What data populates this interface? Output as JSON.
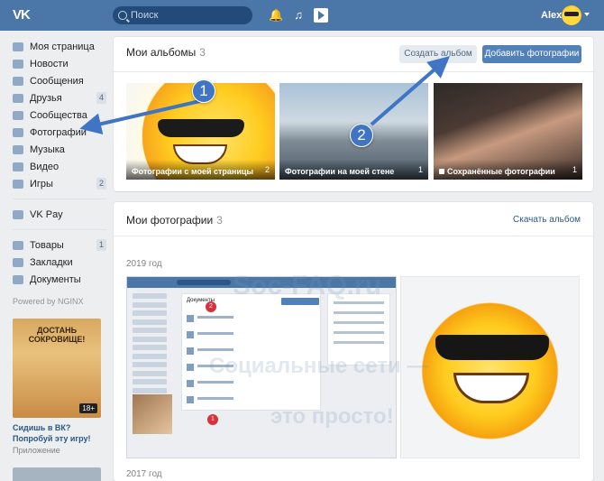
{
  "topbar": {
    "logo": "VK",
    "search_placeholder": "Поиск",
    "user_name": "Alex"
  },
  "sidebar": {
    "items": [
      {
        "label": "Моя страница",
        "icon": "home-icon"
      },
      {
        "label": "Новости",
        "icon": "news-icon"
      },
      {
        "label": "Сообщения",
        "icon": "messages-icon"
      },
      {
        "label": "Друзья",
        "icon": "friends-icon",
        "badge": "4"
      },
      {
        "label": "Сообщества",
        "icon": "groups-icon"
      },
      {
        "label": "Фотографии",
        "icon": "camera-icon"
      },
      {
        "label": "Музыка",
        "icon": "music-icon"
      },
      {
        "label": "Видео",
        "icon": "video-icon"
      },
      {
        "label": "Игры",
        "icon": "games-icon",
        "badge": "2"
      }
    ],
    "vkpay": "VK Pay",
    "items2": [
      {
        "label": "Товары",
        "icon": "goods-icon",
        "badge": "1"
      },
      {
        "label": "Закладки",
        "icon": "bookmark-icon"
      },
      {
        "label": "Документы",
        "icon": "documents-icon"
      }
    ],
    "powered": "Powered by NGINX",
    "promo": {
      "image_title": "ДОСТАНЬ СОКРОВИЩЕ!",
      "age": "18+",
      "text": "Сидишь в ВК? Попробуй эту игру!",
      "sub": "Приложение"
    }
  },
  "albums": {
    "title": "Мои альбомы",
    "count": "3",
    "create_button": "Создать альбом",
    "add_button": "Добавить фотографии",
    "items": [
      {
        "caption": "Фотографии с моей страницы",
        "count": "2"
      },
      {
        "caption": "Фотографии на моей стене",
        "count": "1"
      },
      {
        "caption": "Сохранённые фотографии",
        "count": "1"
      }
    ]
  },
  "photos": {
    "title": "Мои фотографии",
    "count": "3",
    "download_link": "Скачать альбом",
    "year1": "2019 год",
    "year2": "2017 год",
    "screenshot": {
      "title": "Документы",
      "badge1": "1",
      "badge2": "2"
    }
  },
  "watermark": {
    "line1": "Soc-FAQ.ru",
    "line2": "Социальные сети —",
    "line3": "это просто!"
  },
  "annotations": {
    "callout1": "1",
    "callout2": "2"
  },
  "colors": {
    "header": "#4a76a8",
    "accent": "#5181b8",
    "callout": "#3f75c4"
  }
}
